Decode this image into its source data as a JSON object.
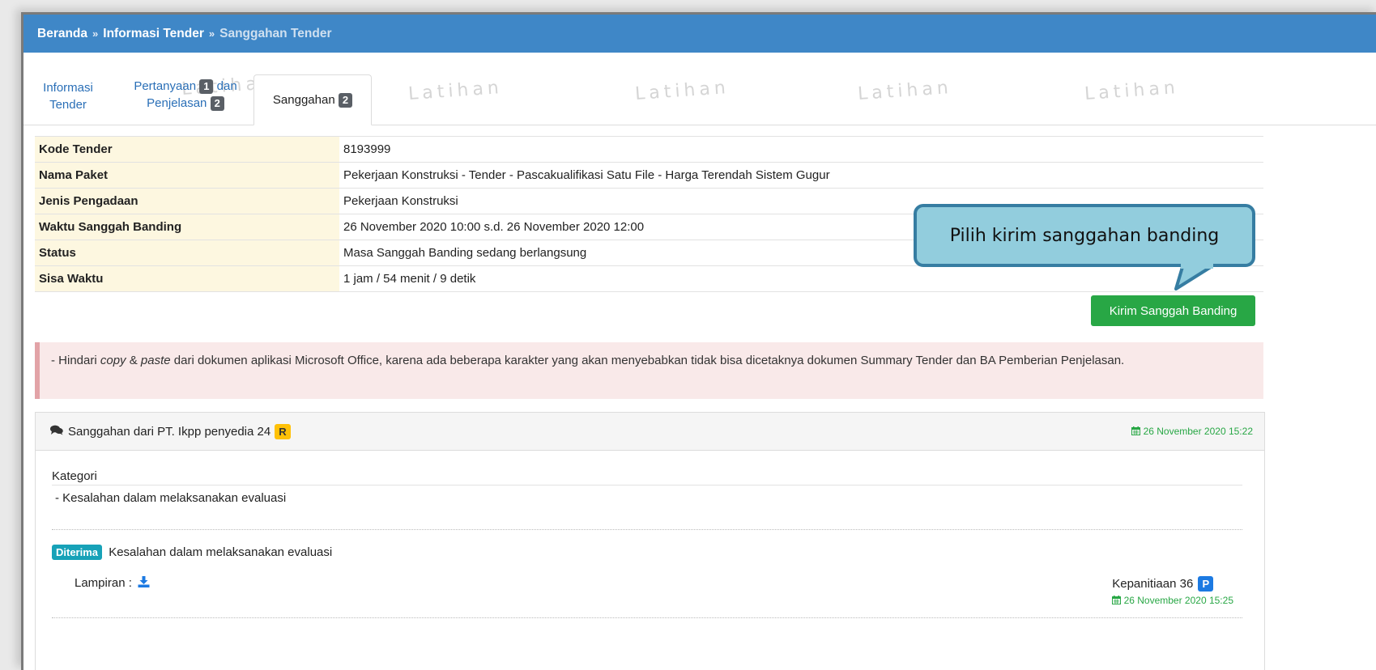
{
  "breadcrumb": {
    "home": "Beranda",
    "sep": "»",
    "info": "Informasi Tender",
    "current": "Sanggahan Tender"
  },
  "tabs": {
    "info_line1": "Informasi",
    "info_line2": "Tender",
    "qa_line1": "Pertanyaan",
    "qa_badge": "1",
    "qa_line1b": "dan",
    "qa_line2": "Penjelasan",
    "qa_badge2": "2",
    "sanggahan": "Sanggahan",
    "sanggahan_badge": "2"
  },
  "watermark": "Latihan",
  "info_table": [
    {
      "label": "Kode Tender",
      "value": "8193999"
    },
    {
      "label": "Nama Paket",
      "value": "Pekerjaan Konstruksi - Tender - Pascakualifikasi Satu File - Harga Terendah Sistem Gugur"
    },
    {
      "label": "Jenis Pengadaan",
      "value": "Pekerjaan Konstruksi"
    },
    {
      "label": "Waktu Sanggah Banding",
      "value": "26 November 2020 10:00 s.d. 26 November 2020 12:00"
    },
    {
      "label": "Status",
      "value": "Masa Sanggah Banding sedang berlangsung"
    },
    {
      "label": "Sisa Waktu",
      "value": "1 jam / 54 menit / 9 detik"
    }
  ],
  "button": {
    "kirim": "Kirim Sanggah Banding"
  },
  "callout": "Pilih kirim sanggahan banding",
  "alert": {
    "prefix": "- Hindari ",
    "copy": "copy",
    "amp": " & ",
    "paste": "paste",
    "rest": " dari dokumen aplikasi Microsoft Office, karena ada beberapa karakter yang akan menyebabkan tidak bisa dicetaknya dokumen Summary Tender dan BA Pemberian Penjelasan."
  },
  "panel": {
    "title": "Sanggahan dari PT. Ikpp penyedia 24",
    "badge": "R",
    "date": "26 November 2020 15:22",
    "kategori_label": "Kategori",
    "kategori_item": "-  Kesalahan dalam melaksanakan evaluasi",
    "status_badge": "Diterima",
    "status_text": "Kesalahan dalam melaksanakan evaluasi",
    "lampiran": "Lampiran :",
    "responder": "Kepanitiaan 36",
    "responder_badge": "P",
    "response_date": "26 November 2020 15:25"
  },
  "colors": {
    "header": "#3f87c7",
    "button": "#28a745",
    "callout_fill": "#92cddd",
    "callout_border": "#367da2"
  }
}
